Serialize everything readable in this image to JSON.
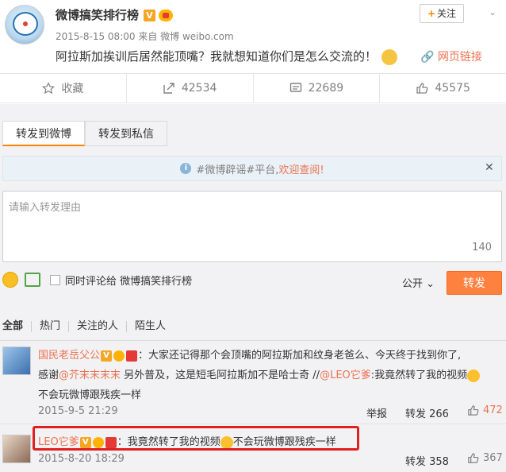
{
  "post": {
    "author": "微博搞笑排行榜",
    "time": "2015-8-15 08:00 来自 微博 weibo.com",
    "text": "阿拉斯加挨训后居然能顶嘴？我就想知道你们是怎么交流的！",
    "follow_label": "关注",
    "link_label": "网页链接"
  },
  "actions": {
    "favorite": "收藏",
    "repost": "42534",
    "comment": "22689",
    "like": "45575"
  },
  "tabs": [
    "转发到微博",
    "转发到私信"
  ],
  "notice": {
    "hashtag": "#微博辟谣#平台,",
    "link": "欢迎查阅!"
  },
  "composer": {
    "placeholder": "请输入转发理由",
    "count": "140",
    "checkbox_label": "同时评论给 微博搞笑排行榜",
    "visibility": "公开",
    "submit": "转发"
  },
  "filters": [
    "全部",
    "热门",
    "关注的人",
    "陌生人"
  ],
  "comments": [
    {
      "user": "国民老岳父公",
      "line1": "：大家还记得那个会顶嘴的阿拉斯加和纹身老爸么、今天终于找到你了,",
      "line2_a": "感谢",
      "line2_mention1": "@芥末末末末",
      "line2_b": "另外普及，这是短毛阿拉斯加不是哈士奇 //",
      "line2_mention2": "@LEO它爹",
      "line2_c": ":我竟然转了我的视频",
      "line3": "不会玩微博跟残疾一样",
      "time": "2015-9-5 21:29",
      "report": "举报",
      "repost": "转发 266",
      "likes": "472"
    },
    {
      "user": "LEO它爹",
      "text_a": "：我竟然转了我的视频",
      "text_b": "不会玩微博跟残疾一样",
      "time": "2015-8-20 18:29",
      "repost": "转发 358",
      "likes": "367"
    }
  ]
}
